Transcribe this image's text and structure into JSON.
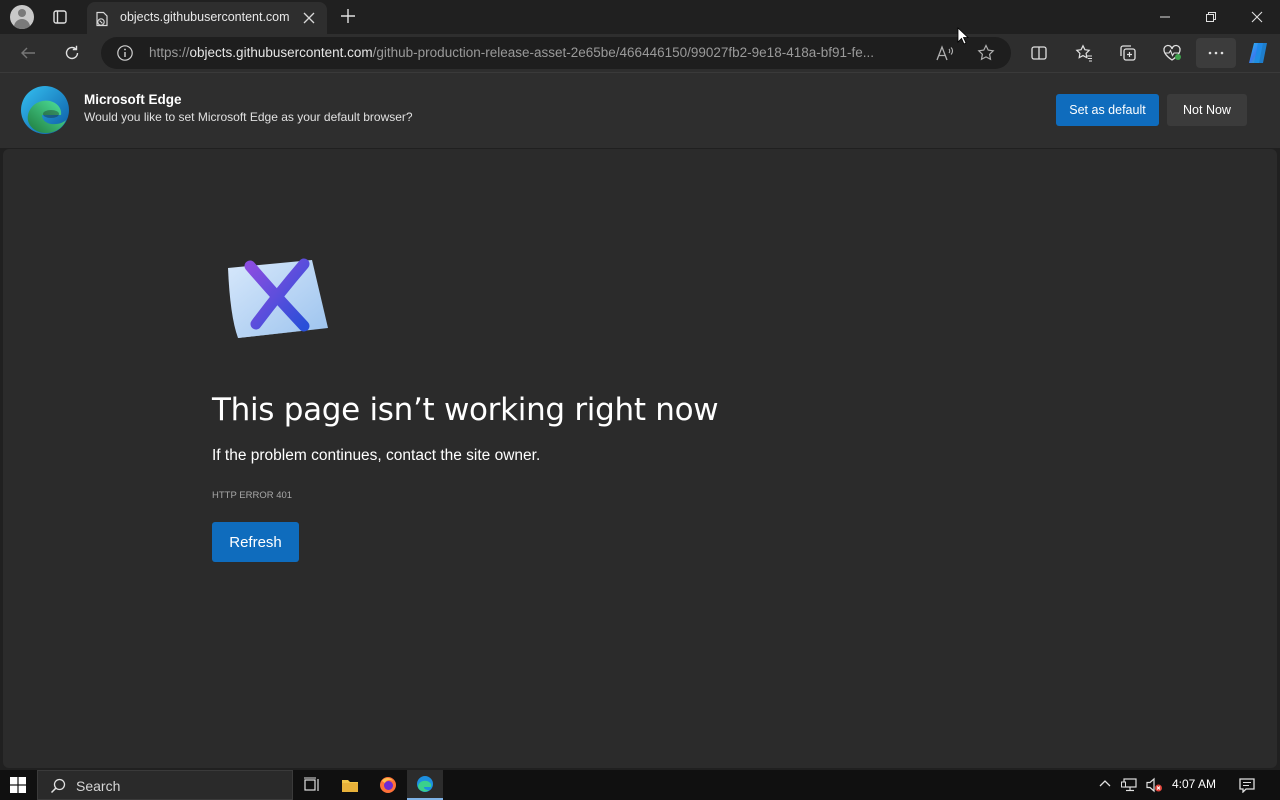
{
  "browser": {
    "tab_title": "objects.githubusercontent.com",
    "url_scheme": "https://",
    "url_host": "objects.githubusercontent.com",
    "url_path": "/github-production-release-asset-2e65be/466446150/99027fb2-9e18-418a-bf91-fe..."
  },
  "infobar": {
    "title": "Microsoft Edge",
    "message": "Would you like to set Microsoft Edge as your default browser?",
    "primary_button": "Set as default",
    "secondary_button": "Not Now"
  },
  "error_page": {
    "heading": "This page isn’t working right now",
    "subtext": "If the problem continues, contact the site owner.",
    "error_code": "HTTP ERROR 401",
    "refresh_label": "Refresh"
  },
  "taskbar": {
    "search_placeholder": "Search",
    "clock": "4:07 AM"
  },
  "colors": {
    "accent_blue": "#0f6cbd",
    "page_background": "#2b2b2b",
    "chrome_background": "#202020"
  }
}
